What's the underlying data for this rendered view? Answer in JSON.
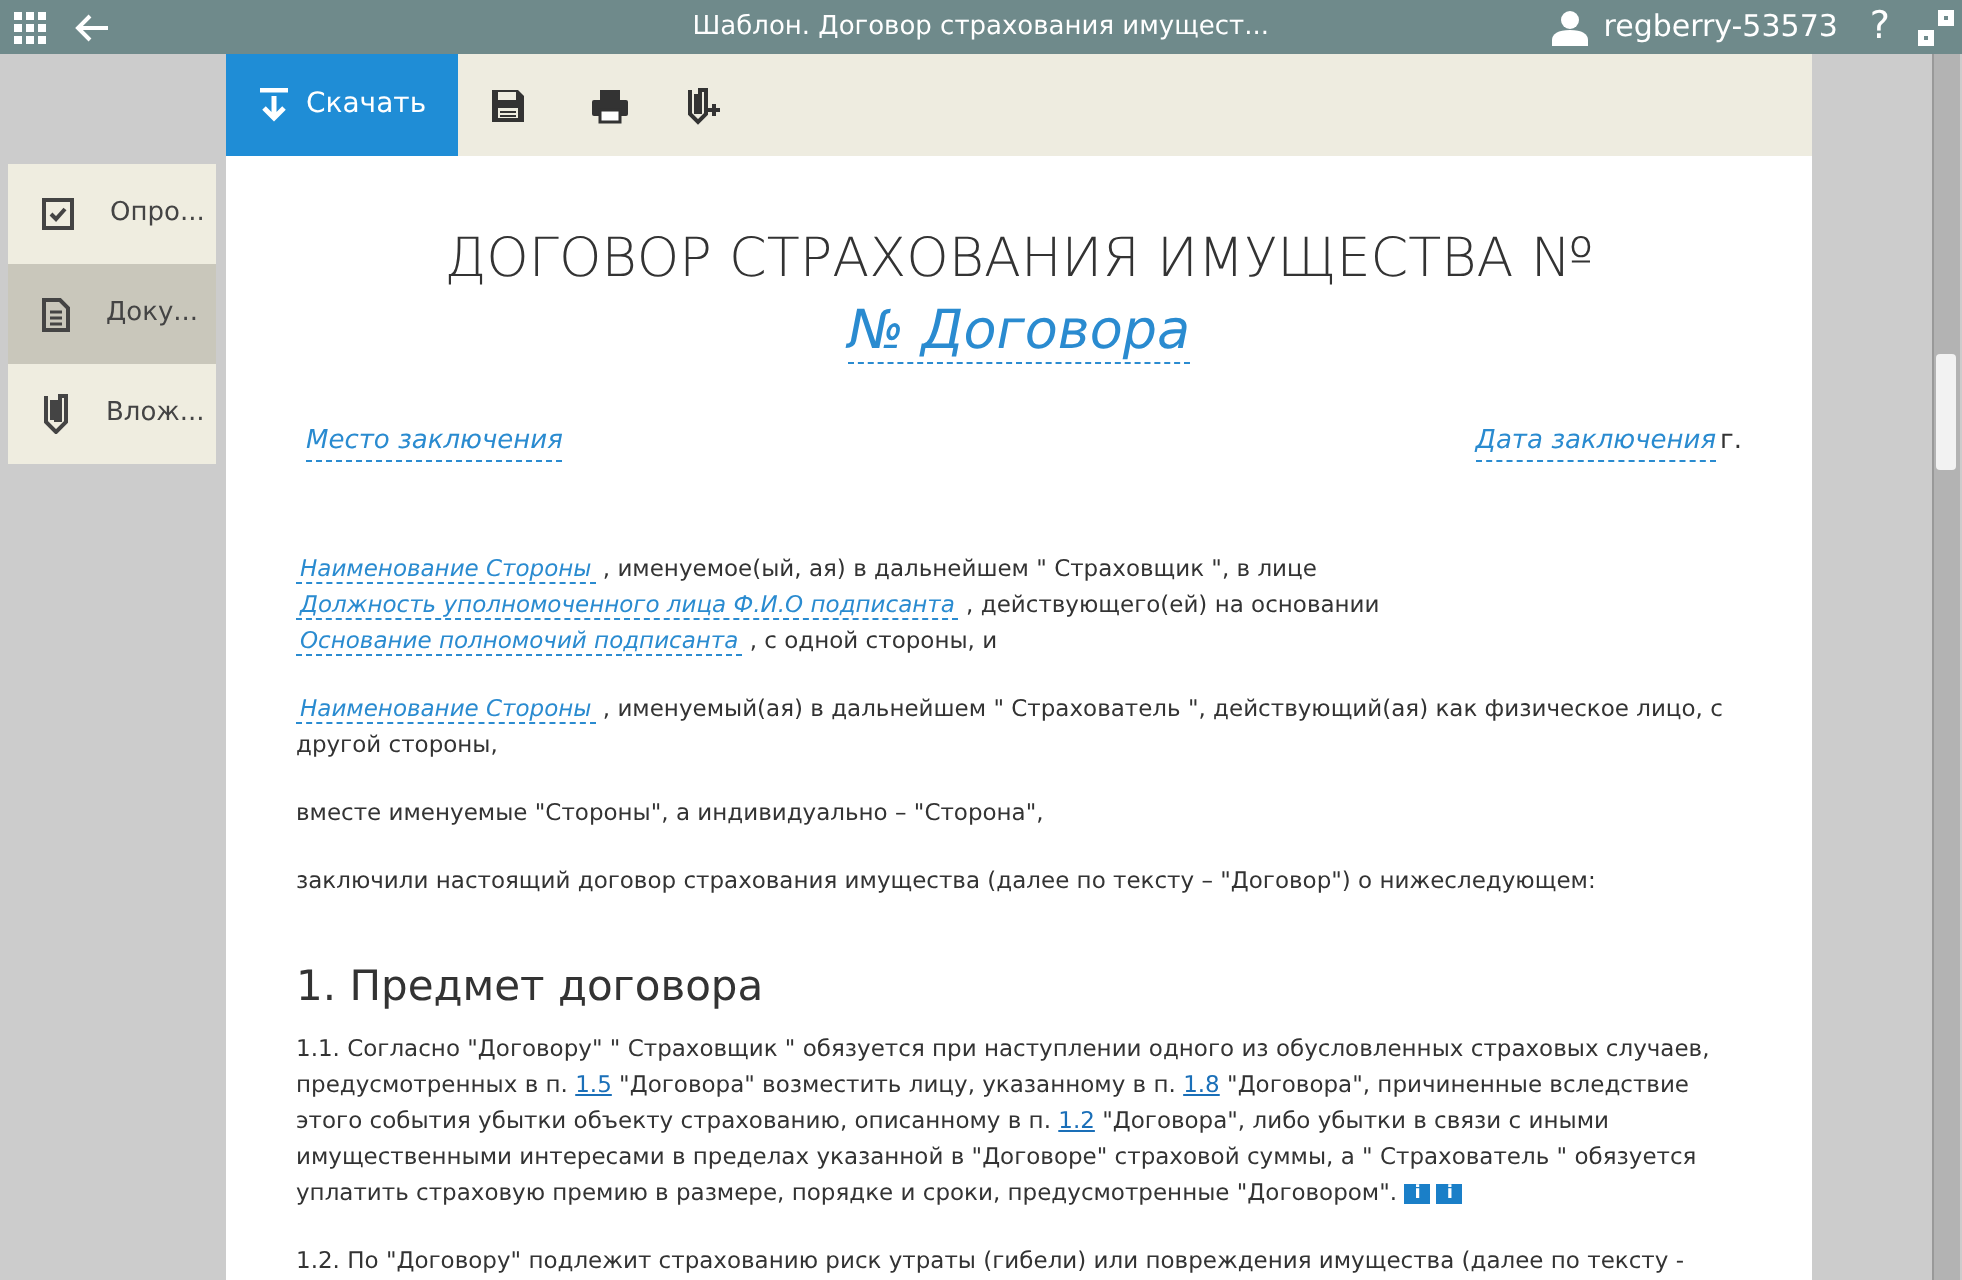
{
  "topbar": {
    "title": "Шаблон. Договор страхования имущест...",
    "user": "regberry-53573",
    "help": "?"
  },
  "toolbar": {
    "download": "Скачать"
  },
  "sidebar": {
    "items": [
      {
        "label": "Опро...",
        "selected": false
      },
      {
        "label": "Доку...",
        "selected": true
      },
      {
        "label": "Влож...",
        "selected": false
      }
    ]
  },
  "document": {
    "title": [
      {
        "kind": "text",
        "text": "ДОГОВОР СТРАХОВАНИЯ ИМУЩЕСТВА №"
      },
      {
        "kind": "field",
        "text": "№ Договора"
      }
    ],
    "place": "Место заключения",
    "date": "Дата заключения",
    "date_suffix": "г.",
    "paragraphs": [
      [
        {
          "kind": "field",
          "text": "Наименование Стороны"
        },
        {
          "kind": "text",
          "text": " , именуемое(ый, ая) в дальнейшем \" Страховщик \", в лице "
        },
        {
          "kind": "field",
          "text": "Должность уполномоченного лица  Ф.И.О подписанта"
        },
        {
          "kind": "text",
          "text": " , действующего(ей) на основании "
        },
        {
          "kind": "field",
          "text": "Основание полномочий подписанта"
        },
        {
          "kind": "text",
          "text": " ,  с одной стороны, и"
        }
      ],
      [
        {
          "kind": "field",
          "text": "Наименование Стороны"
        },
        {
          "kind": "text",
          "text": " , именуемый(ая) в дальнейшем \" Страхователь \", действующий(ая) как физическое лицо,  с другой стороны,"
        }
      ],
      [
        {
          "kind": "text",
          "text": "вместе именуемые \"Стороны\", а индивидуально – \"Сторона\","
        }
      ],
      [
        {
          "kind": "text",
          "text": "заключили настоящий  договор страхования имущества  (далее по тексту – \"Договор\") о нижеследующем:"
        }
      ]
    ],
    "section": "1. Предмет договора",
    "clauses": [
      [
        {
          "kind": "text",
          "text": "1.1.  Согласно \"Договору\" \" Страховщик \" обязуется при наступлении одного из обусловленных страховых случаев, предусмотренных в п. "
        },
        {
          "kind": "ref",
          "text": "1.5"
        },
        {
          "kind": "text",
          "text": " \"Договора\" возместить лицу, указанному в п. "
        },
        {
          "kind": "ref",
          "text": "1.8"
        },
        {
          "kind": "text",
          "text": " \"Договора\", причиненные вследствие этого события убытки объекту страхованию, описанному в п. "
        },
        {
          "kind": "ref",
          "text": "1.2"
        },
        {
          "kind": "text",
          "text": " \"Договора\", либо убытки в связи с иными имущественными интересами в пределах указанной в \"Договоре\" страховой суммы, а \" Страхователь \" обязуется уплатить страховую премию в размере, порядке и сроки, предусмотренные \"Договором\". "
        },
        {
          "kind": "info",
          "text": "i"
        },
        {
          "kind": "info",
          "text": "i"
        }
      ],
      [
        {
          "kind": "text",
          "text": "1.2.  По \"Договору\" подлежит страхованию риск утраты (гибели) или повреждения имущества (далее по тексту -"
        }
      ]
    ]
  }
}
